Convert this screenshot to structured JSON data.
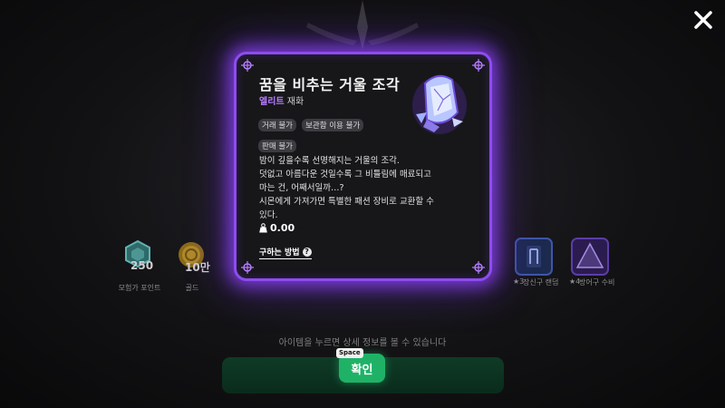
{
  "background": {
    "rewards": [
      {
        "count": "250",
        "name": "모험가 포인트",
        "icon": "adventurer-point-icon"
      },
      {
        "count": "10만",
        "name": "골드",
        "icon": "gold-coin-icon"
      }
    ],
    "faded_labels": [
      "",
      "",
      "",
      "",
      "",
      ""
    ],
    "right_items": [
      {
        "stars": "★3",
        "label": "장신구 랜덤",
        "icon": "rune-icon"
      },
      {
        "stars": "★4",
        "label": "방어구 수비",
        "icon": "armor-pyramid-icon"
      }
    ],
    "hint": "아이템을 누르면 상세 정보를 볼 수 있습니다",
    "confirm_label": "확인",
    "space_key": "Space",
    "close_icon": "close-icon"
  },
  "item": {
    "name": "꿈을 비추는 거울 조각",
    "grade": "엘리트",
    "category": "재화",
    "tags": [
      "거래 불가",
      "보관함 이용 불가",
      "판매 불가"
    ],
    "description": [
      "밤이 깊을수록 선명해지는 거울의 조각.",
      "덧없고 아름다운 것일수록 그 비틀림에 매료되고",
      "마는 건, 어째서일까…?",
      "시몬에게 가져가면 특별한 패션 장비로 교환할 수",
      "있다."
    ],
    "price": "0.00",
    "price_icon": "weight-icon",
    "how_to_get": "구하는 방법",
    "help_icon": "question-icon",
    "image_icon": "mirror-shard-icon"
  },
  "colors": {
    "accent_purple": "#8e4cf0",
    "elite": "#b47cff",
    "confirm_green": "#1fb267"
  }
}
